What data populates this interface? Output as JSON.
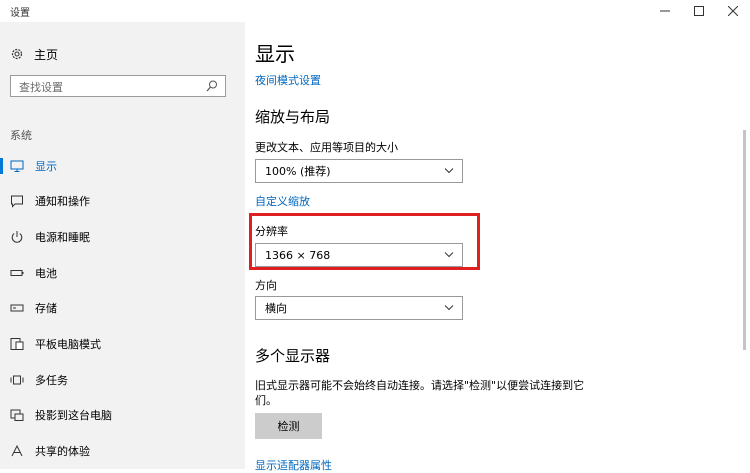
{
  "window": {
    "title": "设置",
    "minimize_symbol": "—",
    "maximize_symbol": "☐",
    "close_symbol": "✕"
  },
  "sidebar": {
    "home_label": "主页",
    "search_placeholder": "查找设置",
    "section_label": "系统",
    "items": [
      {
        "label": "显示",
        "icon": "monitor-icon",
        "active": true
      },
      {
        "label": "通知和操作",
        "icon": "notification-icon",
        "active": false
      },
      {
        "label": "电源和睡眠",
        "icon": "power-icon",
        "active": false
      },
      {
        "label": "电池",
        "icon": "battery-icon",
        "active": false
      },
      {
        "label": "存储",
        "icon": "storage-icon",
        "active": false
      },
      {
        "label": "平板电脑模式",
        "icon": "tablet-mode-icon",
        "active": false
      },
      {
        "label": "多任务",
        "icon": "multitasking-icon",
        "active": false
      },
      {
        "label": "投影到这台电脑",
        "icon": "project-icon",
        "active": false
      },
      {
        "label": "共享的体验",
        "icon": "shared-experience-icon",
        "active": false
      }
    ]
  },
  "main": {
    "title": "显示",
    "night_mode_link": "夜间模式设置",
    "scale_section_title": "缩放与布局",
    "scale_label": "更改文本、应用等项目的大小",
    "scale_value": "100% (推荐)",
    "custom_scale_link": "自定义缩放",
    "resolution_label": "分辨率",
    "resolution_value": "1366 × 768",
    "orientation_label": "方向",
    "orientation_value": "横向",
    "multi_display_title": "多个显示器",
    "multi_display_desc": "旧式显示器可能不会始终自动连接。请选择\"检测\"以便尝试连接到它们。",
    "detect_button": "检测",
    "adapter_link": "显示适配器属性"
  },
  "colors": {
    "accent": "#0078d7",
    "link": "#0067c0",
    "highlight": "#e02020",
    "sidebar_bg": "#f2f2f2"
  }
}
